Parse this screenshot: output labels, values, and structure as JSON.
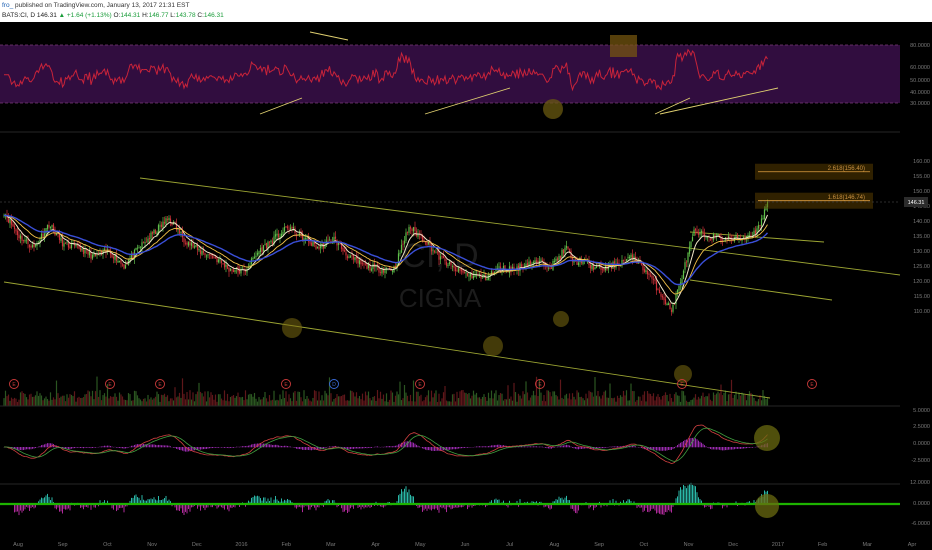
{
  "header": {
    "user": "fro_",
    "published": "published on TradingView.com, January 13, 2017 21:31 EST"
  },
  "ohlc": {
    "symbol": "BATS:CI, D",
    "last": "146.31",
    "change": "+1.64 (+1.13%)",
    "o_label": "O:",
    "o": "144.31",
    "h_label": "H:",
    "h": "146.77",
    "l_label": "L:",
    "l": "143.78",
    "c_label": "C:",
    "c": "146.31"
  },
  "watermark": {
    "symbol": "CI, D",
    "name": "CIGNA"
  },
  "colors": {
    "candle_up": "#5fbf4a",
    "candle_down": "#d0323a",
    "channel": "#b8c23c",
    "ema_fast": "#f0e6c8",
    "ema_mid": "#f2c14a",
    "ema_slow": "#3a4fd8",
    "rsi_band": "#3a0f4a",
    "rsi_line": "#c8233a",
    "macd_hist": "#9b2bb0",
    "hist_up": "#2ab8a8",
    "hist_down": "#b02b9b",
    "zero_line": "#1db300",
    "price_badge": "#2c2c2c",
    "fib_box": "#6a4a00"
  },
  "chart_data": {
    "type": "candlestick",
    "x_ticks": [
      "Aug",
      "Sep",
      "Oct",
      "Nov",
      "Dec",
      "2016",
      "Feb",
      "Mar",
      "Apr",
      "May",
      "Jun",
      "Jul",
      "Aug",
      "Sep",
      "Oct",
      "Nov",
      "Dec",
      "2017",
      "Feb",
      "Mar",
      "Apr"
    ],
    "price_ticks": [
      160,
      155,
      150,
      145,
      140,
      135,
      130,
      125,
      120,
      115,
      110
    ],
    "rsi_ticks": [
      "80.0000",
      "60.0000",
      "50.0000",
      "40.0000",
      "30.0000"
    ],
    "macd_ticks": [
      "5.0000",
      "2.5000",
      "0.0000",
      "-2.5000"
    ],
    "hist_ticks": [
      "12.0000",
      "0.0000",
      "-6.0000"
    ],
    "price_label": "146.31",
    "fib_levels": [
      {
        "label": "2.618(156.40)",
        "value": 156.4
      },
      {
        "label": "1.618(146.74)",
        "value": 146.74
      }
    ],
    "earnings_marker": "E",
    "dividend_marker": "D",
    "close_anchors": [
      [
        0,
        143
      ],
      [
        10,
        135
      ],
      [
        20,
        131
      ],
      [
        30,
        139
      ],
      [
        40,
        132
      ],
      [
        50,
        131
      ],
      [
        60,
        128
      ],
      [
        70,
        130
      ],
      [
        80,
        125
      ],
      [
        90,
        131
      ],
      [
        100,
        136
      ],
      [
        110,
        141
      ],
      [
        120,
        134
      ],
      [
        130,
        130
      ],
      [
        140,
        128
      ],
      [
        150,
        124
      ],
      [
        160,
        123
      ],
      [
        170,
        130
      ],
      [
        180,
        134
      ],
      [
        190,
        138
      ],
      [
        200,
        134
      ],
      [
        210,
        131
      ],
      [
        220,
        134
      ],
      [
        230,
        128
      ],
      [
        240,
        125
      ],
      [
        250,
        124
      ],
      [
        260,
        124
      ],
      [
        265,
        131
      ],
      [
        270,
        138
      ],
      [
        280,
        134
      ],
      [
        290,
        128
      ],
      [
        300,
        124
      ],
      [
        310,
        122
      ],
      [
        320,
        121
      ],
      [
        330,
        124
      ],
      [
        340,
        124
      ],
      [
        350,
        126
      ],
      [
        360,
        126
      ],
      [
        365,
        125
      ],
      [
        370,
        128
      ],
      [
        375,
        131
      ],
      [
        380,
        126
      ],
      [
        385,
        127
      ],
      [
        390,
        125
      ],
      [
        400,
        124
      ],
      [
        410,
        126
      ],
      [
        420,
        128
      ],
      [
        430,
        122
      ],
      [
        440,
        114
      ],
      [
        445,
        110
      ],
      [
        450,
        118
      ],
      [
        460,
        136
      ],
      [
        470,
        135
      ],
      [
        480,
        134
      ],
      [
        490,
        134
      ],
      [
        500,
        136
      ],
      [
        505,
        140
      ],
      [
        509,
        146.31
      ]
    ]
  }
}
